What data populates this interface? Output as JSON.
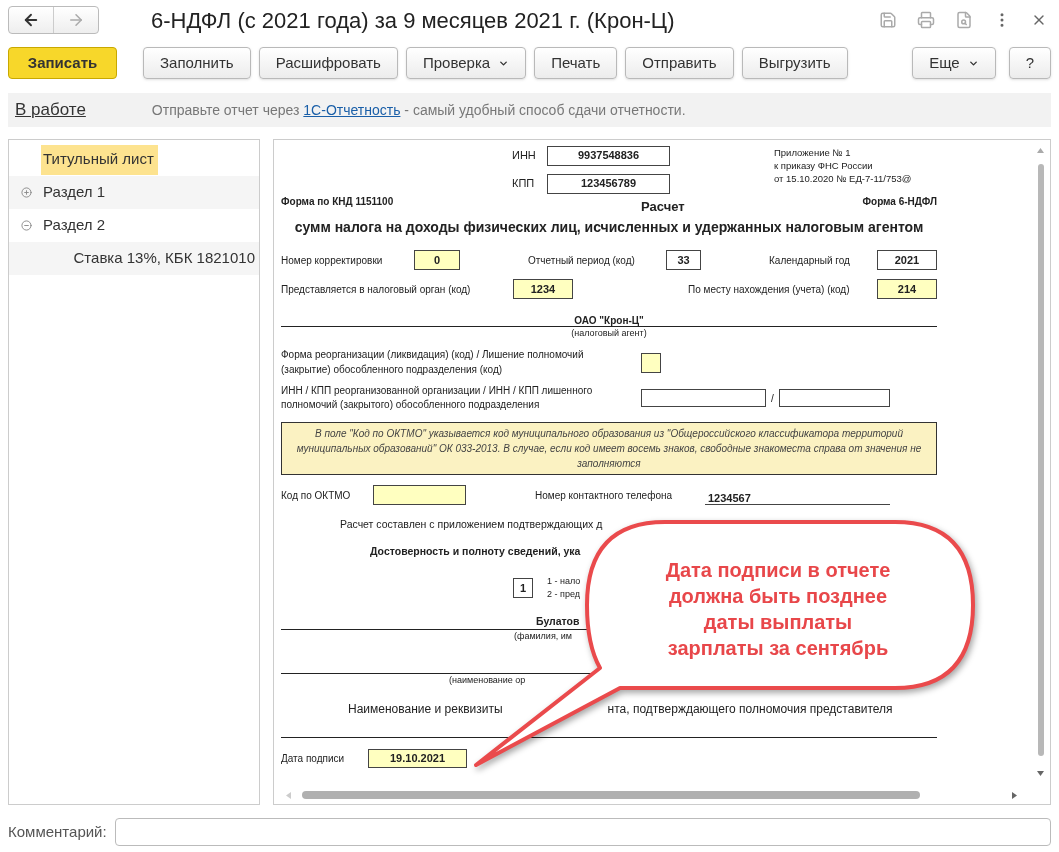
{
  "window": {
    "title": "6-НДФЛ (с 2021 года) за 9 месяцев 2021 г. (Крон-Ц)"
  },
  "toolbar": {
    "buttons": [
      {
        "label": "Записать",
        "kind": "primary"
      },
      {
        "label": "Заполнить",
        "kind": "plain"
      },
      {
        "label": "Расшифровать",
        "kind": "plain"
      },
      {
        "label": "Проверка",
        "kind": "dropdown"
      },
      {
        "label": "Печать",
        "kind": "plain"
      },
      {
        "label": "Отправить",
        "kind": "plain"
      },
      {
        "label": "Выгрузить",
        "kind": "plain"
      }
    ],
    "more": "Еще",
    "help": "?"
  },
  "info_bar": {
    "status": "В работе",
    "message_before": "Отправьте отчет через ",
    "link": "1С-Отчетность",
    "message_after": " - самый удобный способ сдачи отчетности."
  },
  "sidebar": {
    "items": [
      {
        "label": "Титульный лист",
        "selected": true
      },
      {
        "label": "Раздел 1",
        "selected": false,
        "expanded": false
      },
      {
        "label": "Раздел 2",
        "selected": false,
        "expanded": true,
        "children": [
          {
            "label": "Ставка 13%, КБК 1821010",
            "selected": false
          }
        ]
      }
    ]
  },
  "form": {
    "inn_label": "ИНН",
    "inn": "9937548836",
    "kpp_label": "КПП",
    "kpp": "123456789",
    "appendix": [
      "Приложение № 1",
      "к приказу ФНС России",
      "от 15.10.2020 № ЕД-7-11/753@"
    ],
    "knd": "Форма по КНД 1151100",
    "form_name": "Форма 6-НДФЛ",
    "title": "Расчет",
    "subtitle": "сумм налога на доходы физических лиц, исчисленных и удержанных налоговым агентом",
    "row1": [
      {
        "label": "Номер корректировки",
        "value": "0",
        "editable": true
      },
      {
        "label": "Отчетный период (код)",
        "value": "33",
        "editable": false
      },
      {
        "label": "Календарный год",
        "value": "2021",
        "editable": false
      }
    ],
    "row2": [
      {
        "label": "Представляется в налоговый орган (код)",
        "value": "1234",
        "editable": true
      },
      {
        "label": "По месту нахождения (учета) (код)",
        "value": "214",
        "editable": true
      }
    ],
    "agent": "ОАО \"Крон-Ц\"",
    "agent_caption": "(налоговый агент)",
    "reorg_label": "Форма реорганизации (ликвидация) (код) / Лишение полномочий (закрытие) обособленного подразделения (код)",
    "reorg_inn_label": "ИНН / КПП реорганизованной организации / ИНН / КПП лишенного полномочий (закрытого) обособленного подразделения",
    "reorg_separator": "/",
    "note": "В поле \"Код по ОКТМО\" указывается код муниципального образования из \"Общероссийского классификатора территорий муниципальных образований\" ОК 033-2013. В случае, если код имеет восемь знаков, свободные знакоместа справа от значения не заполняются",
    "oktmo_label": "Код по ОКТМО",
    "phone_label": "Номер контактного телефона",
    "phone": "1234567",
    "attachment_text": "Расчет составлен с приложением подтверждающих д",
    "reliability": "Достоверность и полноту сведений, ука",
    "signer_code": "1",
    "signer_options": [
      "1 - нало",
      "2 - пред"
    ],
    "signer_name": "Булатов",
    "signer_caption": "(фамилия, им",
    "org_caption": "(наименование ор",
    "doc_text": [
      "Наименование и реквизиты",
      "нта, подтверждающего полномочия представителя"
    ],
    "sign_date_label": "Дата подписи",
    "sign_date": "19.10.2021"
  },
  "callout": {
    "lines": [
      "Дата подписи в отчете",
      "должна быть позднее",
      "даты выплаты",
      "зарплаты за сентябрь"
    ]
  },
  "comment": {
    "label": "Комментарий:"
  }
}
